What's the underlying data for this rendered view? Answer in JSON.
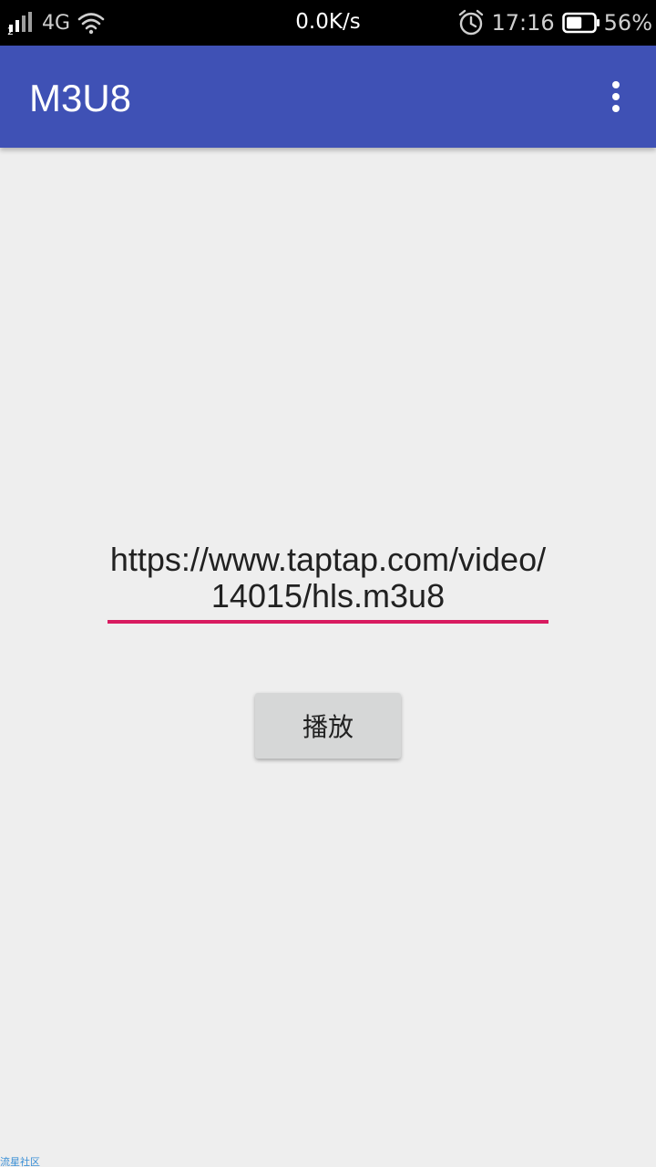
{
  "status_bar": {
    "sim_slot": "2",
    "network_type": "4G",
    "net_speed": "0.0K/s",
    "time": "17:16",
    "battery_percent": "56%",
    "battery_level": 0.56,
    "icons": [
      "signal-icon",
      "wifi-icon",
      "alarm-icon",
      "battery-icon"
    ]
  },
  "app_bar": {
    "title": "M3U8",
    "background_color": "#3f51b5",
    "overflow_icon": "more-vert-icon"
  },
  "url_input": {
    "value": "https://www.taptap.com/video/14015/hls.m3u8",
    "underline_color": "#d81b60"
  },
  "play_button": {
    "label": "播放"
  },
  "watermark": {
    "text": "流星社区"
  }
}
